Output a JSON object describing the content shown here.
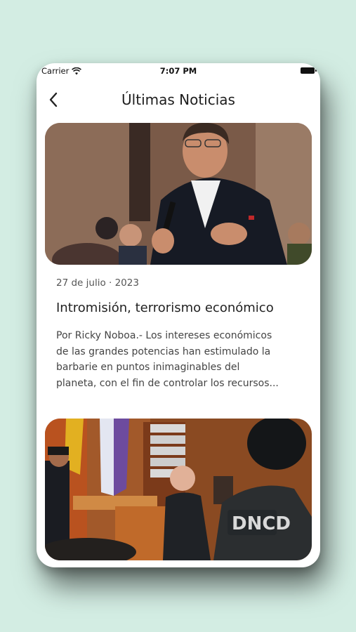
{
  "status": {
    "carrier": "Carrier",
    "time": "7:07 PM"
  },
  "header": {
    "title": "Últimas Noticias",
    "back_icon": "chevron-left-icon"
  },
  "articles": [
    {
      "date": "27 de julio · 2023",
      "title": "Intromisión, terrorismo económico",
      "excerpt_lines": [
        "Por Ricky Noboa.- Los intereses económicos",
        "de las grandes potencias han estimulado la",
        "barbarie en puntos inimaginables del",
        "planeta, con el fin de controlar los recursos..."
      ]
    },
    {
      "image_text": "DNCD"
    }
  ],
  "colors": {
    "background": "#d3ede3",
    "card": "#ffffff",
    "text": "#222222"
  }
}
